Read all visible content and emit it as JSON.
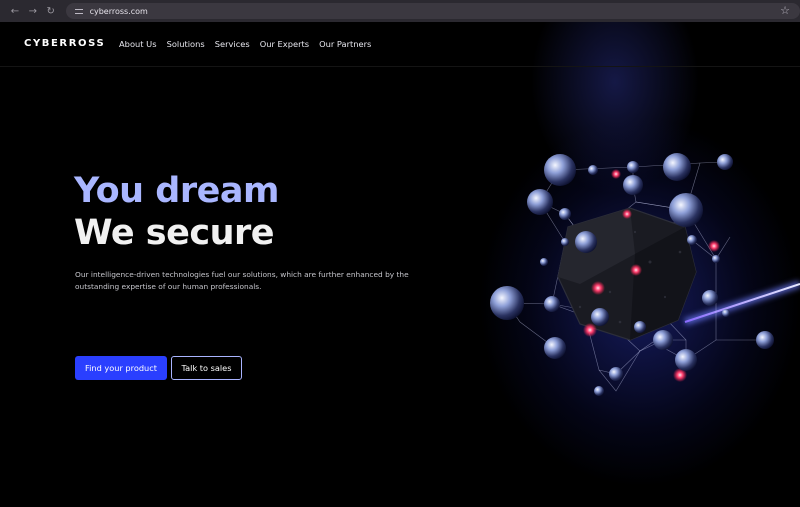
{
  "browser": {
    "url": "cyberross.com",
    "back_icon": "arrow-left-icon",
    "forward_icon": "arrow-right-icon",
    "reload_icon": "reload-icon",
    "bookmark_icon": "star-icon"
  },
  "header": {
    "logo": "CYBERROSS",
    "nav": [
      "About Us",
      "Solutions",
      "Services",
      "Our Experts",
      "Our Partners"
    ]
  },
  "hero": {
    "line1": "You dream",
    "line2": "We secure",
    "subtitle": "Our intelligence-driven technologies fuel our solutions, which are further enhanced by the outstanding expertise of our human professionals.",
    "primary_button": "Find your product",
    "secondary_button": "Talk to sales"
  },
  "colors": {
    "accent": "#2a3fff",
    "headline_light": "#a9b6ff",
    "background": "#000000"
  }
}
